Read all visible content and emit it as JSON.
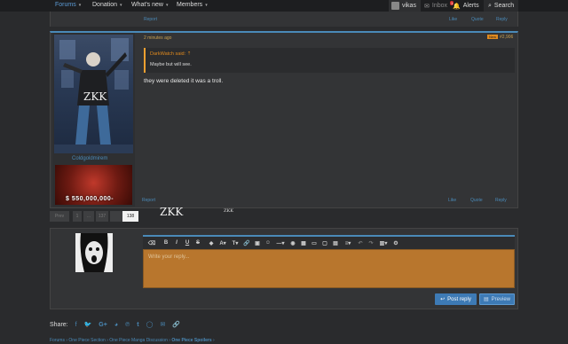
{
  "nav": {
    "items": [
      {
        "label": "Forums"
      },
      {
        "label": "Donation"
      },
      {
        "label": "What's new"
      },
      {
        "label": "Members"
      }
    ],
    "user": "vikas",
    "inbox": "Inbox",
    "alerts": "Alerts",
    "alert_count": "1",
    "search": "Search"
  },
  "post_prev": {
    "left_link": "Report",
    "links": [
      "Like",
      "Quote",
      "Reply"
    ]
  },
  "post": {
    "username": "Coldgoldmirem",
    "time": "2 minutes ago",
    "badge": "New",
    "post_number": "#2,906",
    "quote_author": "DarkWatch said:",
    "quote_text": "Maybe but will see.",
    "message": "they were deleted it was a troll.",
    "banner_text": "$ 550,000,000-",
    "avatar_mark": "ZKK",
    "footer_left": "Report",
    "footer_links": [
      "Like",
      "Quote",
      "Reply"
    ]
  },
  "pagination": {
    "pages": [
      "Prev",
      "1",
      "...",
      "137",
      "138"
    ],
    "current": "138"
  },
  "watermark": {
    "big": "ZKK",
    "small": "ZKK"
  },
  "reply": {
    "placeholder": "Write your reply...",
    "post_button": "Post reply",
    "preview_button": "Preview"
  },
  "share": {
    "label": "Share:",
    "icons": [
      "facebook-icon",
      "twitter-icon",
      "google-plus-icon",
      "reddit-icon",
      "pinterest-icon",
      "tumblr-icon",
      "whatsapp-icon",
      "email-icon",
      "link-icon"
    ]
  },
  "breadcrumb": [
    "Forums",
    "One Piece Section",
    "One Piece Manga Discussion",
    "One Piece Spoilers"
  ]
}
